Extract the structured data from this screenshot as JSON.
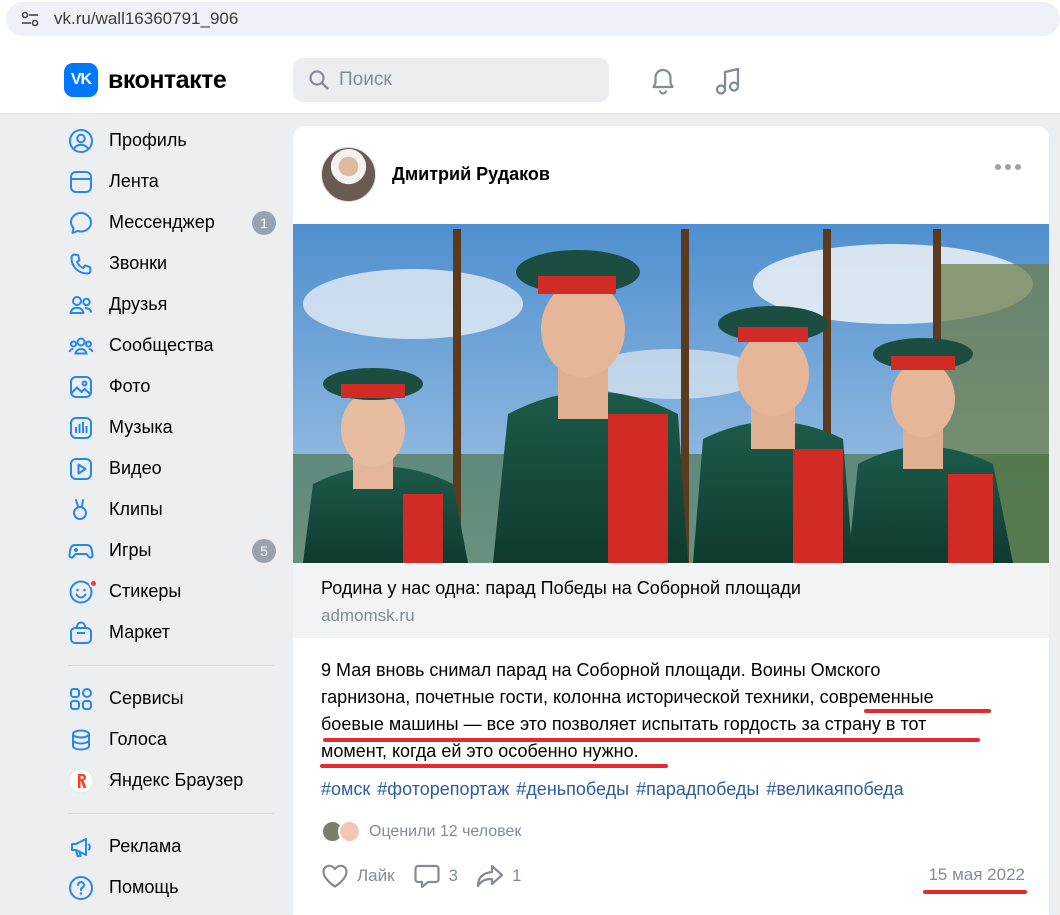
{
  "browser": {
    "url": "vk.ru/wall16360791_906"
  },
  "header": {
    "logo_mark": "VK",
    "logo_text": "вконтакте",
    "search_placeholder": "Поиск"
  },
  "sidebar": {
    "items": [
      {
        "label": "Профиль",
        "icon": "profile-icon"
      },
      {
        "label": "Лента",
        "icon": "feed-icon"
      },
      {
        "label": "Мессенджер",
        "icon": "messenger-icon",
        "badge": "1"
      },
      {
        "label": "Звонки",
        "icon": "phone-icon"
      },
      {
        "label": "Друзья",
        "icon": "friends-icon"
      },
      {
        "label": "Сообщества",
        "icon": "communities-icon"
      },
      {
        "label": "Фото",
        "icon": "photo-icon"
      },
      {
        "label": "Музыка",
        "icon": "music-icon"
      },
      {
        "label": "Видео",
        "icon": "video-icon"
      },
      {
        "label": "Клипы",
        "icon": "clips-icon"
      },
      {
        "label": "Игры",
        "icon": "games-icon",
        "badge": "5"
      },
      {
        "label": "Стикеры",
        "icon": "stickers-icon"
      },
      {
        "label": "Маркет",
        "icon": "market-icon"
      }
    ],
    "items2": [
      {
        "label": "Сервисы",
        "icon": "services-icon"
      },
      {
        "label": "Голоса",
        "icon": "votes-icon"
      },
      {
        "label": "Яндекс Браузер",
        "icon": "yandex-icon"
      }
    ],
    "items3": [
      {
        "label": "Реклама",
        "icon": "ads-icon"
      },
      {
        "label": "Помощь",
        "icon": "help-icon"
      }
    ]
  },
  "post": {
    "author": "Дмитрий Рудаков",
    "link_title": "Родина у нас одна: парад Победы на Соборной площади",
    "link_source": "admomsk.ru",
    "text_lines": [
      "9 Мая вновь снимал парад на Соборной площади. Воины Омского",
      "гарнизона, почетные гости, колонна исторической техники, ",
      "современные",
      "боевые машины — все это позволяет испытать гордость за страну в тот",
      "момент, когда ей это особенно нужно."
    ],
    "hashtags": [
      "#омск",
      "#фоторепортаж",
      "#деньпобеды",
      "#парадпобеды",
      "#великаяпобеда"
    ],
    "liked_text": "Оценили 12 человек",
    "like_label": "Лайк",
    "comments_count": "3",
    "shares_count": "1",
    "date": "15 мая 2022",
    "highlight_color": "#e8282f"
  }
}
